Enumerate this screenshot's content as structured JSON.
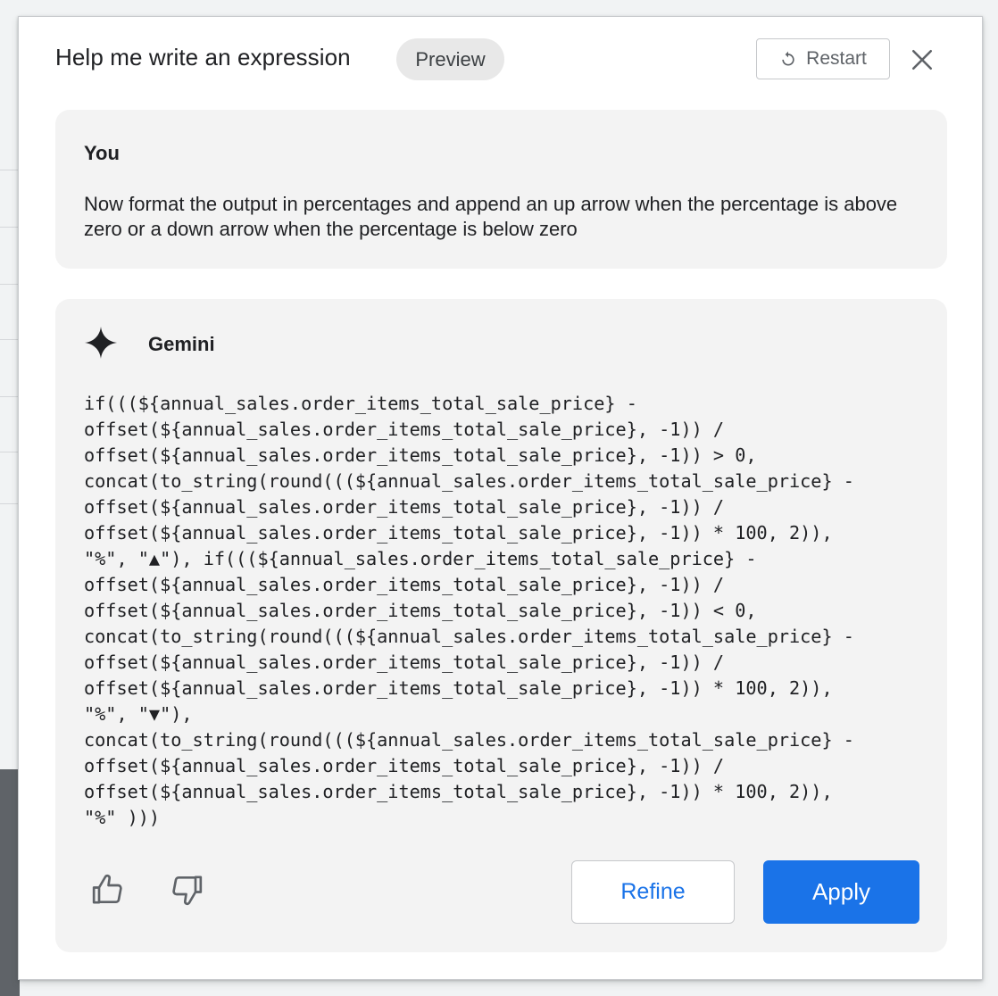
{
  "header": {
    "title": "Help me write an expression",
    "badge": "Preview",
    "restart_label": "Restart"
  },
  "user_message": {
    "author": "You",
    "text": "Now format the output in percentages and append an up arrow when the percentage is above zero or a down arrow when the percentage is below zero"
  },
  "response": {
    "author": "Gemini",
    "code_lines": [
      "if(((${annual_sales.order_items_total_sale_price} -",
      "offset(${annual_sales.order_items_total_sale_price}, -1)) /",
      "offset(${annual_sales.order_items_total_sale_price}, -1)) > 0,",
      "concat(to_string(round(((${annual_sales.order_items_total_sale_price} -",
      "offset(${annual_sales.order_items_total_sale_price}, -1)) /",
      "offset(${annual_sales.order_items_total_sale_price}, -1)) * 100, 2)),",
      "\"%\", \"▲\"), if(((${annual_sales.order_items_total_sale_price} -",
      "offset(${annual_sales.order_items_total_sale_price}, -1)) /",
      "offset(${annual_sales.order_items_total_sale_price}, -1)) < 0,",
      "concat(to_string(round(((${annual_sales.order_items_total_sale_price} -",
      "offset(${annual_sales.order_items_total_sale_price}, -1)) /",
      "offset(${annual_sales.order_items_total_sale_price}, -1)) * 100, 2)),",
      "\"%\", \"▼\"),",
      "concat(to_string(round(((${annual_sales.order_items_total_sale_price} -",
      "offset(${annual_sales.order_items_total_sale_price}, -1)) /",
      "offset(${annual_sales.order_items_total_sale_price}, -1)) * 100, 2)),",
      "\"%\" )))"
    ],
    "refine_label": "Refine",
    "apply_label": "Apply"
  },
  "icons": {
    "restart": "restart-icon",
    "close": "close-icon",
    "gemini": "gemini-sparkle-icon",
    "thumbs_up": "thumbs-up-icon",
    "thumbs_down": "thumbs-down-icon"
  },
  "colors": {
    "accent": "#1a73e8",
    "card_background": "#f3f3f3",
    "chip_background": "#e8e8e8",
    "text": "#202124"
  }
}
